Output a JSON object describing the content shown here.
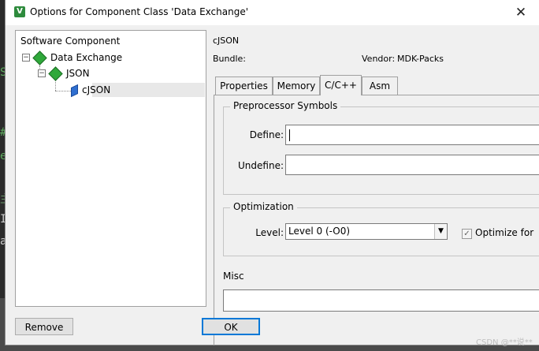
{
  "background_glyphs": [
    "S",
    "#",
    "e",
    "主",
    "I",
    "a"
  ],
  "window": {
    "title": "Options for Component Class 'Data Exchange'",
    "close_glyph": "✕"
  },
  "tree": {
    "header": "Software Component",
    "items": [
      {
        "label": "Data Exchange",
        "expander": "−"
      },
      {
        "label": "JSON",
        "expander": "−"
      },
      {
        "label": "cJSON"
      }
    ]
  },
  "info": {
    "component_name": "cJSON",
    "bundle_label": "Bundle:",
    "bundle_value": "",
    "vendor_label": "Vendor:",
    "vendor_value": "MDK-Packs"
  },
  "tabs": [
    {
      "label": "Properties",
      "active": false
    },
    {
      "label": "Memory",
      "active": false
    },
    {
      "label": "C/C++",
      "active": true
    },
    {
      "label": "Asm",
      "active": false
    }
  ],
  "preprocessor": {
    "title": "Preprocessor Symbols",
    "define_label": "Define:",
    "define_value": "",
    "undefine_label": "Undefine:",
    "undefine_value": ""
  },
  "optimization": {
    "title": "Optimization",
    "level_label": "Level:",
    "level_value": "Level 0 (-O0)",
    "optimize_label": "Optimize for",
    "optimize_checked": true
  },
  "misc": {
    "title": "Misc",
    "value": ""
  },
  "buttons": {
    "remove": "Remove",
    "ok": "OK"
  },
  "watermark": "CSDN @**说**"
}
